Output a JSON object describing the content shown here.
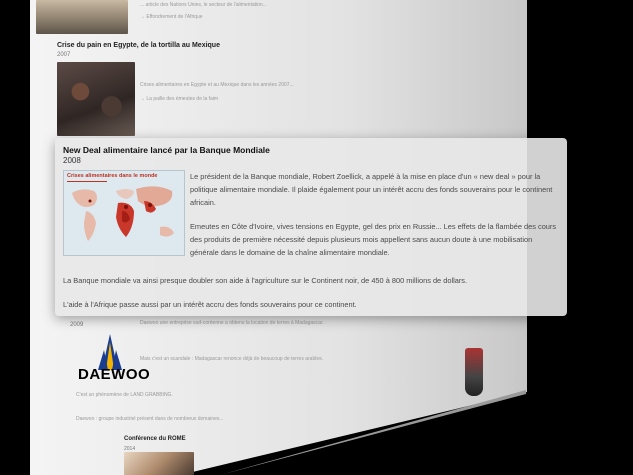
{
  "background_page": {
    "items": [
      {
        "title": "",
        "year": "",
        "caption": "→ Effondrement de l'Afrique",
        "text": "... article des Nations Unies, le secteur de l'alimentation..."
      },
      {
        "title": "Crise du pain en Egypte, de la tortilla au Mexique",
        "year": "2007",
        "caption": "→ La paille des émeutes de la faim",
        "text": "Crises alimentaires en Egypte et au Mexique dans les années 2007..."
      },
      {
        "title": "",
        "year": "2009",
        "caption": "",
        "text": "Daewoo une entreprise sud-coréenne a obtenu la location de terres à Madagascar."
      },
      {
        "title": "",
        "year": "",
        "caption": "",
        "text": "Mais c'est un scandale : Madagascar renonce déjà de beaucoup de terres arables."
      },
      {
        "title": "",
        "year": "",
        "caption": "",
        "text": "C'est un phénomène de LAND GRABBING."
      },
      {
        "title": "",
        "year": "",
        "caption": "",
        "text": "Daewoo : groupe industriel présent dans de nombreux domaines..."
      },
      {
        "title": "Conférence du ROME",
        "year": "2014",
        "caption": "",
        "text": ""
      }
    ],
    "logo_text": "DAEWOO"
  },
  "popup": {
    "title": "New Deal alimentaire lancé par la Banque Mondiale",
    "year": "2008",
    "map_title": "Crises alimentaires dans le monde",
    "paragraphs": [
      "Le président de la Banque mondiale, Robert Zoellick, a appelé à la mise en place d'un « new deal » pour la politique alimentaire mondiale. Il plaide également pour un intérêt accru des fonds souverains pour le continent africain.",
      "Emeutes en Côte d'Ivoire, vives tensions en Egypte, gel des prix en Russie... Les effets de la flambée des cours des produits de première nécessité depuis plusieurs mois appellent sans aucun doute à une mobilisation générale dans le domaine de la chaîne alimentaire mondiale.",
      "La Banque mondiale va ainsi presque doubler son aide à l'agriculture sur le Continent noir, de 450 à 800 millions de dollars.",
      "L'aide à l'Afrique passe aussi par un intérêt accru des fonds souverains pour ce continent."
    ]
  }
}
